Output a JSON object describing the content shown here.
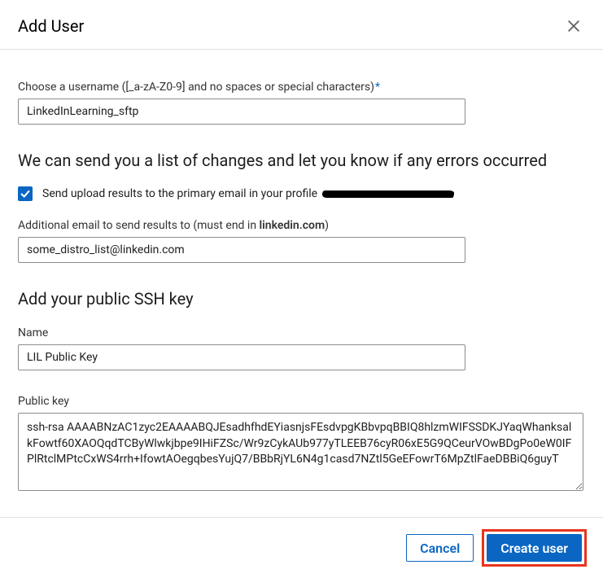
{
  "header": {
    "title": "Add User"
  },
  "username": {
    "label": "Choose a username ([_a-zA-Z0-9] and no spaces or special characters)",
    "required_marker": "*",
    "value": "LinkedInLearning_sftp"
  },
  "notify": {
    "heading": "We can send you a list of changes and let you know if any errors occurred",
    "checkbox_checked": true,
    "checkbox_label": "Send upload results to the primary email in your profile"
  },
  "additional_email": {
    "label_prefix": "Additional email to send results to (must end in ",
    "label_bold": "linkedin.com",
    "label_suffix": ")",
    "value": "some_distro_list@linkedin.com"
  },
  "ssh": {
    "heading": "Add your public SSH key",
    "name_label": "Name",
    "name_value": "LIL Public Key",
    "key_label": "Public key",
    "key_value": "ssh-rsa AAAABNzAC1zyc2EAAAABQJEsadhfhdEYiasnjsFEsdvpgKBbvpqBBIQ8hlzmWIFSSDKJYaqWhanksalkFowtf60XAOQqdTCByWlwkjbpe9IHiFZSc/Wr9zCykAUb977yTLEEB76cyR06xE5G9QCeurVOwBDgPo0eW0IFPlRtclMPtcCxWS4rrh+IfowtAOegqbesYujQ7/BBbRjYL6N4g1casd7NZtl5GeEFowrT6MpZtlFaeDBBiQ6guyT"
  },
  "footer": {
    "cancel_label": "Cancel",
    "create_label": "Create user"
  }
}
